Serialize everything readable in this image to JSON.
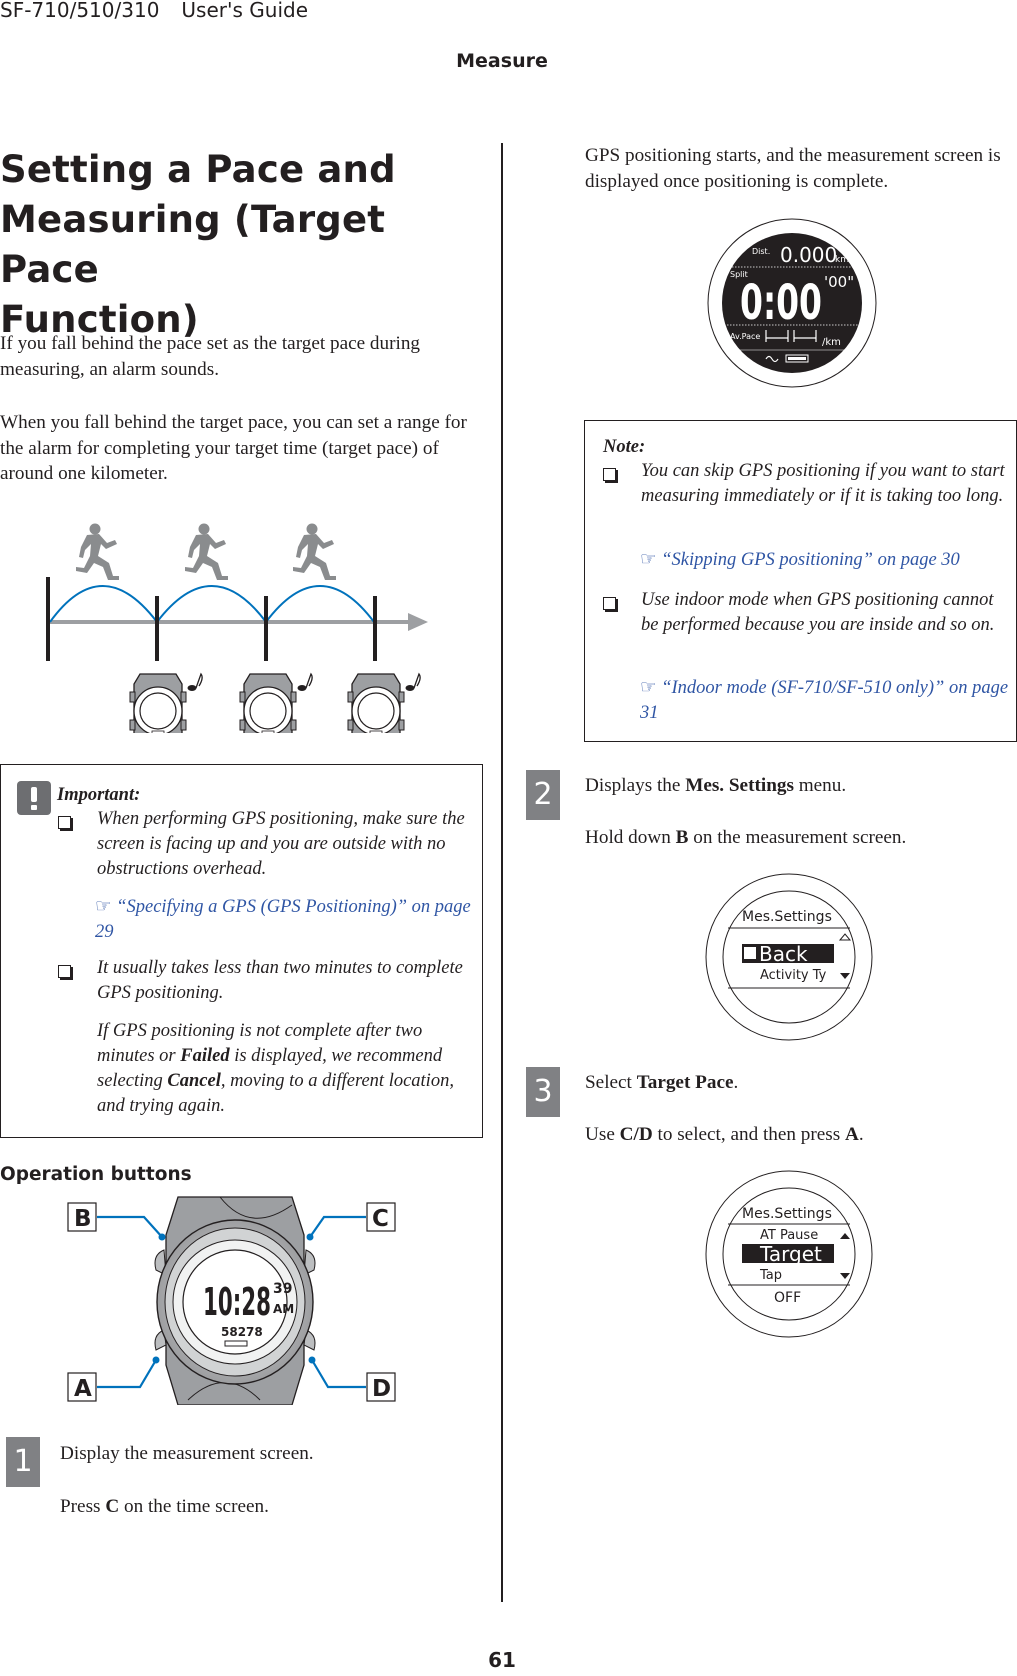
{
  "header": {
    "model": "SF-710/510/310",
    "guide": "User's Guide",
    "section": "Measure"
  },
  "title": "Setting a Pace and Measuring (Target Pace Function)",
  "title_lines": [
    "Setting a Pace and",
    "Measuring (Target Pace",
    "Function)"
  ],
  "intro": {
    "p1": "If you fall behind the pace set as the target pace during measuring, an alarm sounds.",
    "p2": "When you fall behind the target pace, you can set a range for the alarm for completing your target time (target pace) of around one kilometer."
  },
  "diagram": {
    "runner_icon": "running-person-icon",
    "watch_icon": "watch-icon",
    "alarm_icon": "music-note-icon",
    "arc_color": "#0072bc",
    "axis_color": "#9d9fa2",
    "runner_color": "#8a8c8e"
  },
  "important": {
    "label": "Important:",
    "icon": "exclamation-icon",
    "items": [
      {
        "text": "When performing GPS positioning, make sure the screen is facing up and you are outside with no obstructions overhead.",
        "link": "“Specifying a GPS (GPS Positioning)” on page 29"
      },
      {
        "text": "It usually takes less than two minutes to complete GPS positioning.",
        "sub_pre": "If GPS positioning is not complete after two minutes or ",
        "sub_b1": "Failed",
        "sub_mid": " is displayed, we recommend selecting ",
        "sub_b2": "Cancel",
        "sub_post": ", moving to a different location, and trying again."
      }
    ]
  },
  "operation": {
    "heading": "Operation buttons",
    "buttons": [
      "A",
      "B",
      "C",
      "D"
    ],
    "watch_time": "10:28",
    "watch_seconds": "39",
    "watch_ampm": "AM",
    "watch_sub": "58278",
    "leader_color": "#0072bc"
  },
  "steps": [
    {
      "num": "1",
      "title": "Display the measurement screen.",
      "desc_pre": "Press ",
      "desc_b": "C",
      "desc_post": " on the time screen."
    },
    {
      "num": "2",
      "title_pre": "Displays the ",
      "title_b": "Mes. Settings",
      "title_post": " menu.",
      "desc_pre": "Hold down ",
      "desc_b": "B",
      "desc_post": " on the measurement screen."
    },
    {
      "num": "3",
      "title_pre": "Select ",
      "title_b": "Target Pace",
      "title_post": ".",
      "desc_pre": "Use ",
      "desc_b": "C/D",
      "desc_mid": " to select, and then press ",
      "desc_b2": "A",
      "desc_post": "."
    }
  ],
  "gps_text": "GPS positioning starts, and the measurement screen is displayed once positioning is complete.",
  "measure_screen": {
    "dist_label": "Dist.",
    "dist_value": "0.000",
    "dist_unit": "km",
    "split_label": "Split",
    "split_value": "0:00",
    "split_sub": "'00\"",
    "pace_label": "Av.Pace",
    "pace_unit": "/km"
  },
  "note": {
    "label": "Note:",
    "items": [
      {
        "text": "You can skip GPS positioning if you want to start measuring immediately or if it is taking too long.",
        "link": "“Skipping GPS positioning” on page 30"
      },
      {
        "text": "Use indoor mode when GPS positioning cannot be performed because you are inside and so on.",
        "link": "“Indoor mode (SF-710/SF-510 only)” on page 31"
      }
    ]
  },
  "menu_screen_1": {
    "title": "Mes.Settings",
    "selected": "Back",
    "next": "Activity Ty",
    "selected_icon": "back-arrow-icon"
  },
  "menu_screen_2": {
    "title": "Mes.Settings",
    "prev": "AT Pause",
    "selected": "Target",
    "next": "Tap",
    "value": "OFF"
  },
  "link_icon": "pointing-hand-icon",
  "page_number": "61"
}
